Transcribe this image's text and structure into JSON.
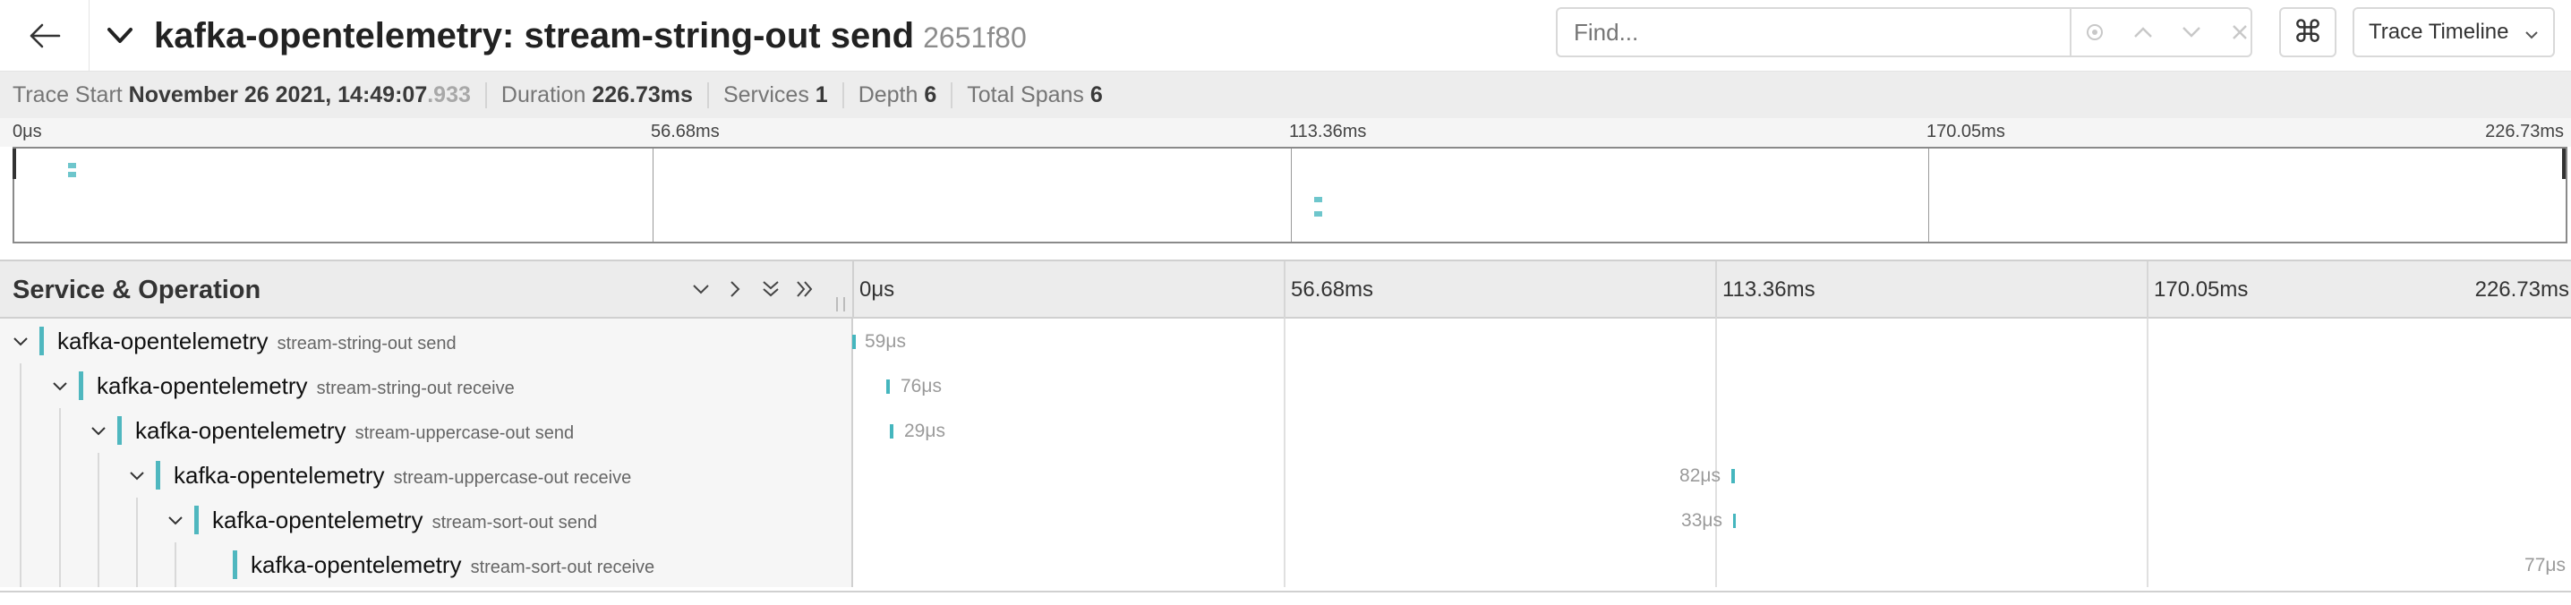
{
  "title": {
    "service": "kafka-opentelemetry",
    "operation": "stream-string-out send",
    "separator": ": ",
    "trace_id": "2651f80"
  },
  "find": {
    "placeholder": "Find..."
  },
  "shortcut_glyph": "⌘",
  "view_selector": {
    "label": "Trace Timeline"
  },
  "summary": {
    "trace_start_label": "Trace Start",
    "trace_start_value": "November 26 2021, 14:49:07",
    "trace_start_ms": ".933",
    "duration_label": "Duration",
    "duration_value": "226.73ms",
    "services_label": "Services",
    "services_value": "1",
    "depth_label": "Depth",
    "depth_value": "6",
    "total_spans_label": "Total Spans",
    "total_spans_value": "6"
  },
  "ticks": [
    "0μs",
    "56.68ms",
    "113.36ms",
    "170.05ms",
    "226.73ms"
  ],
  "header": {
    "service_operation": "Service & Operation"
  },
  "spans": [
    {
      "service": "kafka-opentelemetry",
      "operation": "stream-string-out send",
      "duration": "59μs",
      "depth": 0,
      "has_children": true
    },
    {
      "service": "kafka-opentelemetry",
      "operation": "stream-string-out receive",
      "duration": "76μs",
      "depth": 1,
      "has_children": true
    },
    {
      "service": "kafka-opentelemetry",
      "operation": "stream-uppercase-out send",
      "duration": "29μs",
      "depth": 2,
      "has_children": true
    },
    {
      "service": "kafka-opentelemetry",
      "operation": "stream-uppercase-out receive",
      "duration": "82μs",
      "depth": 3,
      "has_children": true
    },
    {
      "service": "kafka-opentelemetry",
      "operation": "stream-sort-out send",
      "duration": "33μs",
      "depth": 4,
      "has_children": true
    },
    {
      "service": "kafka-opentelemetry",
      "operation": "stream-sort-out receive",
      "duration": "77μs",
      "depth": 5,
      "has_children": false
    }
  ],
  "colors": {
    "service_accent": "#4fb7bf",
    "span_bar": "#45b6be"
  }
}
